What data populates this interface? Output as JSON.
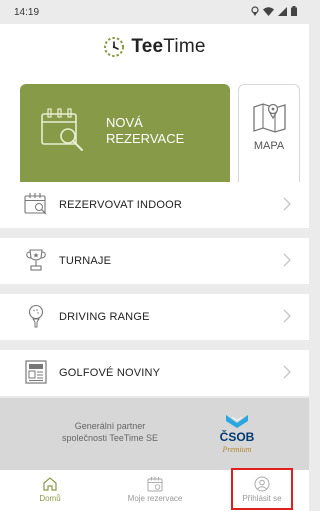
{
  "statusbar": {
    "time": "14:19",
    "icons": [
      "location-icon",
      "wifi-icon",
      "signal-icon",
      "battery-icon"
    ]
  },
  "header": {
    "logo_bold": "Tee",
    "logo_rest": "Time"
  },
  "tiles": {
    "primary_line1": "NOVÁ",
    "primary_line2": "REZERVACE",
    "secondary": "MAPA"
  },
  "menu": {
    "items": [
      {
        "label": "REZERVOVAT INDOOR",
        "icon": "calendar-icon"
      },
      {
        "label": "TURNAJE",
        "icon": "trophy-icon"
      },
      {
        "label": "DRIVING RANGE",
        "icon": "golf-ball-tee-icon"
      },
      {
        "label": "GOLFOVÉ NOVINY",
        "icon": "newspaper-icon"
      }
    ]
  },
  "partner": {
    "line1": "Generální partner",
    "line2": "společnosti TeeTime SE",
    "brand": "ČSOB",
    "brand_sub": "Premium"
  },
  "nav": {
    "home": "Domů",
    "reservations": "Moje rezervace",
    "login": "Přihlásit se"
  },
  "colors": {
    "accent": "#869a47",
    "accent_dark": "#5c6e2c",
    "highlight": "#e02020"
  }
}
